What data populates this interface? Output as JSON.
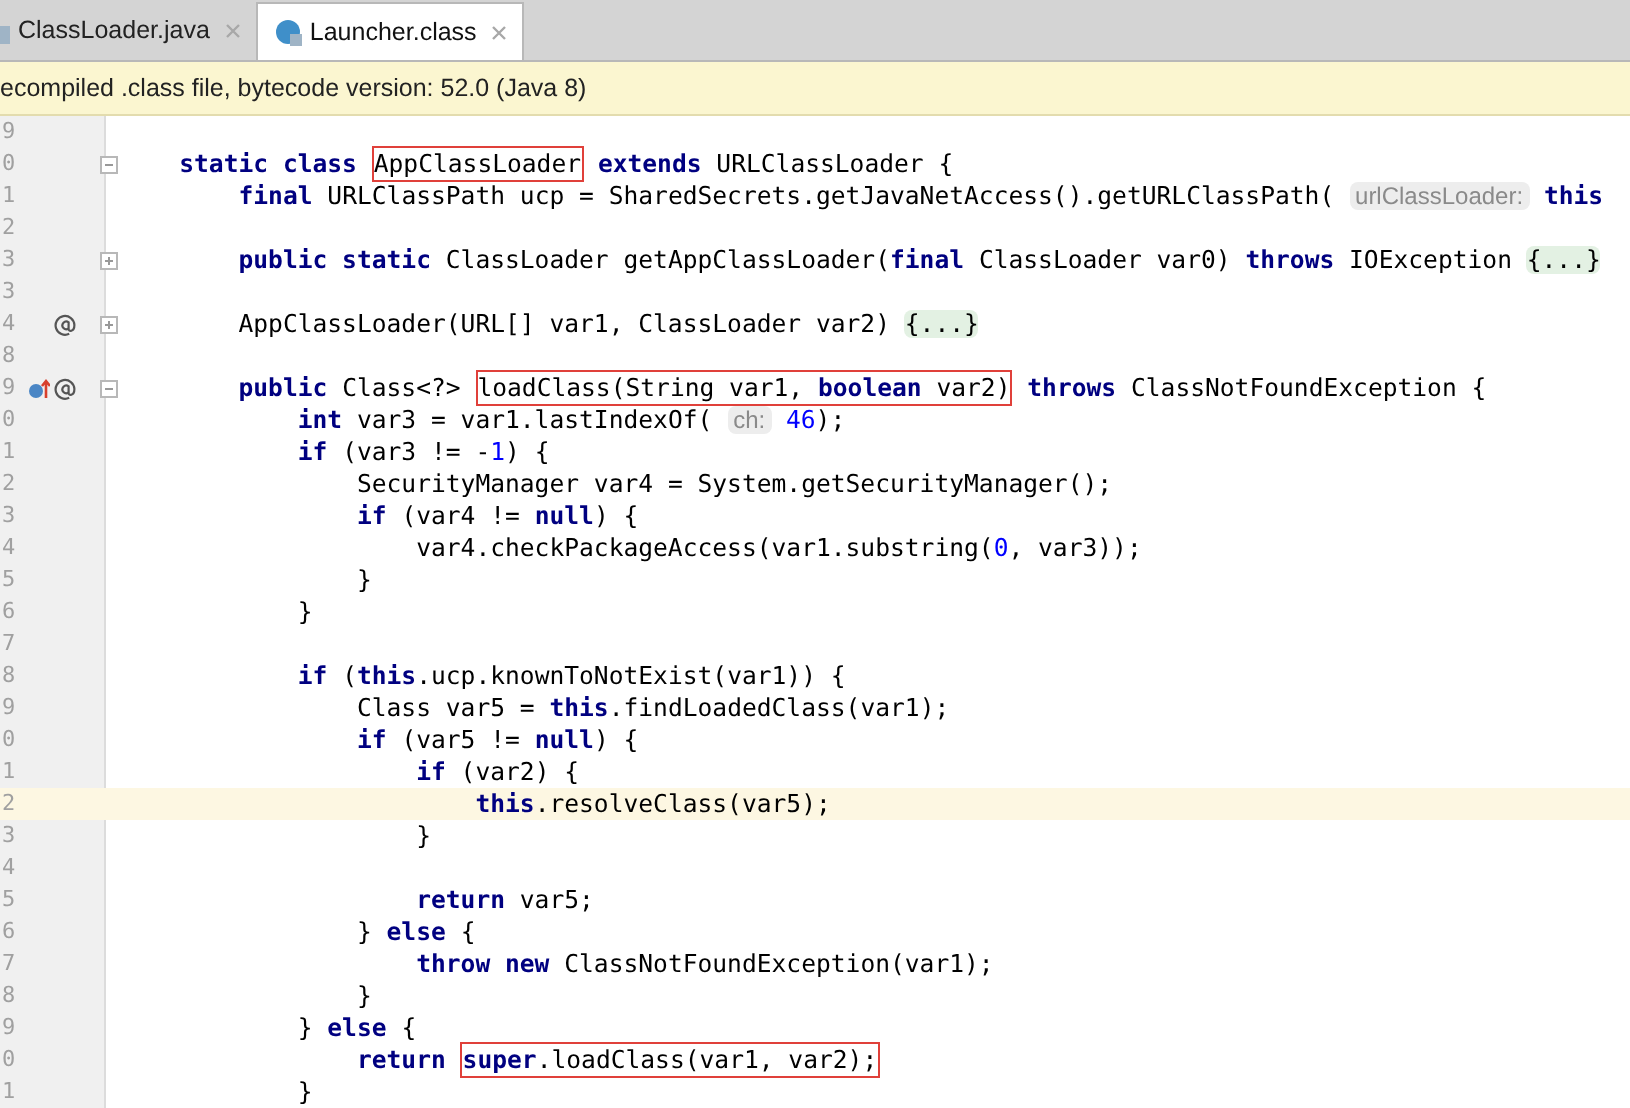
{
  "tabs": [
    {
      "label": "ClassLoader.java",
      "selected": false
    },
    {
      "label": "Launcher.class",
      "selected": true
    }
  ],
  "banner": "ecompiled .class file, bytecode version: 52.0 (Java 8)",
  "lines": [
    {
      "number": "9",
      "highlighted": false
    },
    {
      "number": "0",
      "highlighted": false,
      "expanded": true,
      "code": [
        {
          "kind": "kw",
          "text": "    static class "
        },
        {
          "kind": "box",
          "parts": [
            {
              "kind": "text",
              "text": "AppClassLoader"
            }
          ]
        },
        {
          "kind": "kw",
          "text": " extends "
        },
        {
          "kind": "text",
          "text": "URLClassLoader {"
        }
      ]
    },
    {
      "number": "1",
      "highlighted": false,
      "code": [
        {
          "kind": "kw",
          "text": "        final "
        },
        {
          "kind": "text",
          "text": "URLClassPath ucp = SharedSecrets.getJavaNetAccess().getURLClassPath( "
        },
        {
          "kind": "hint",
          "text": "urlClassLoader:"
        },
        {
          "kind": "kw",
          "text": " this"
        }
      ]
    },
    {
      "number": "2",
      "highlighted": false
    },
    {
      "number": "3",
      "highlighted": false,
      "expanded": false,
      "code": [
        {
          "kind": "kw",
          "text": "        public static "
        },
        {
          "kind": "text",
          "text": "ClassLoader getAppClassLoader("
        },
        {
          "kind": "kw",
          "text": "final "
        },
        {
          "kind": "text",
          "text": "ClassLoader var0) "
        },
        {
          "kind": "kw",
          "text": "throws "
        },
        {
          "kind": "text",
          "text": "IOException "
        },
        {
          "kind": "fold",
          "text": "{...}"
        }
      ]
    },
    {
      "number": "3",
      "highlighted": false
    },
    {
      "number": "4",
      "highlighted": false,
      "expanded": false,
      "annotation_marker": true,
      "code": [
        {
          "kind": "text",
          "text": "        AppClassLoader(URL[] var1, ClassLoader var2) "
        },
        {
          "kind": "fold",
          "text": "{...}"
        }
      ]
    },
    {
      "number": "8",
      "highlighted": false
    },
    {
      "number": "9",
      "highlighted": false,
      "expanded": true,
      "override_marker": true,
      "annotation_marker": true,
      "code": [
        {
          "kind": "kw",
          "text": "        public "
        },
        {
          "kind": "text",
          "text": "Class<?> "
        },
        {
          "kind": "box",
          "parts": [
            {
              "kind": "text",
              "text": "loadClass(String var1, "
            },
            {
              "kind": "kw",
              "text": "boolean "
            },
            {
              "kind": "text",
              "text": "var2)"
            }
          ]
        },
        {
          "kind": "kw",
          "text": " throws "
        },
        {
          "kind": "text",
          "text": "ClassNotFoundException {"
        }
      ]
    },
    {
      "number": "0",
      "highlighted": false,
      "code": [
        {
          "kind": "kw",
          "text": "            int "
        },
        {
          "kind": "text",
          "text": "var3 = var1.lastIndexOf( "
        },
        {
          "kind": "hint",
          "text": "ch:"
        },
        {
          "kind": "num",
          "text": " 46"
        },
        {
          "kind": "text",
          "text": ");"
        }
      ]
    },
    {
      "number": "1",
      "highlighted": false,
      "code": [
        {
          "kind": "kw",
          "text": "            if "
        },
        {
          "kind": "text",
          "text": "(var3 != -"
        },
        {
          "kind": "num",
          "text": "1"
        },
        {
          "kind": "text",
          "text": ") {"
        }
      ]
    },
    {
      "number": "2",
      "highlighted": false,
      "code": [
        {
          "kind": "text",
          "text": "                SecurityManager var4 = System.getSecurityManager();"
        }
      ]
    },
    {
      "number": "3",
      "highlighted": false,
      "code": [
        {
          "kind": "kw",
          "text": "                if "
        },
        {
          "kind": "text",
          "text": "(var4 != "
        },
        {
          "kind": "kw",
          "text": "null"
        },
        {
          "kind": "text",
          "text": ") {"
        }
      ]
    },
    {
      "number": "4",
      "highlighted": false,
      "code": [
        {
          "kind": "text",
          "text": "                    var4.checkPackageAccess(var1.substring("
        },
        {
          "kind": "num",
          "text": "0"
        },
        {
          "kind": "text",
          "text": ", var3));"
        }
      ]
    },
    {
      "number": "5",
      "highlighted": false,
      "code": [
        {
          "kind": "text",
          "text": "                }"
        }
      ]
    },
    {
      "number": "6",
      "highlighted": false,
      "code": [
        {
          "kind": "text",
          "text": "            }"
        }
      ]
    },
    {
      "number": "7",
      "highlighted": false
    },
    {
      "number": "8",
      "highlighted": false,
      "code": [
        {
          "kind": "kw",
          "text": "            if "
        },
        {
          "kind": "text",
          "text": "("
        },
        {
          "kind": "kw",
          "text": "this"
        },
        {
          "kind": "text",
          "text": ".ucp.knownToNotExist(var1)) {"
        }
      ]
    },
    {
      "number": "9",
      "highlighted": false,
      "code": [
        {
          "kind": "text",
          "text": "                Class var5 = "
        },
        {
          "kind": "kw",
          "text": "this"
        },
        {
          "kind": "text",
          "text": ".findLoadedClass(var1);"
        }
      ]
    },
    {
      "number": "0",
      "highlighted": false,
      "code": [
        {
          "kind": "kw",
          "text": "                if "
        },
        {
          "kind": "text",
          "text": "(var5 != "
        },
        {
          "kind": "kw",
          "text": "null"
        },
        {
          "kind": "text",
          "text": ") {"
        }
      ]
    },
    {
      "number": "1",
      "highlighted": false,
      "code": [
        {
          "kind": "kw",
          "text": "                    if "
        },
        {
          "kind": "text",
          "text": "(var2) {"
        }
      ]
    },
    {
      "number": "2",
      "highlighted": true,
      "code": [
        {
          "kind": "kw",
          "text": "                        this"
        },
        {
          "kind": "text",
          "text": ".resolveClass(var5);"
        }
      ]
    },
    {
      "number": "3",
      "highlighted": false,
      "code": [
        {
          "kind": "text",
          "text": "                    }"
        }
      ]
    },
    {
      "number": "4",
      "highlighted": false
    },
    {
      "number": "5",
      "highlighted": false,
      "code": [
        {
          "kind": "kw",
          "text": "                    return "
        },
        {
          "kind": "text",
          "text": "var5;"
        }
      ]
    },
    {
      "number": "6",
      "highlighted": false,
      "code": [
        {
          "kind": "text",
          "text": "                } "
        },
        {
          "kind": "kw",
          "text": "else "
        },
        {
          "kind": "text",
          "text": "{"
        }
      ]
    },
    {
      "number": "7",
      "highlighted": false,
      "code": [
        {
          "kind": "kw",
          "text": "                    throw new "
        },
        {
          "kind": "text",
          "text": "ClassNotFoundException(var1);"
        }
      ]
    },
    {
      "number": "8",
      "highlighted": false,
      "code": [
        {
          "kind": "text",
          "text": "                }"
        }
      ]
    },
    {
      "number": "9",
      "highlighted": false,
      "code": [
        {
          "kind": "text",
          "text": "            } "
        },
        {
          "kind": "kw",
          "text": "else "
        },
        {
          "kind": "text",
          "text": "{"
        }
      ]
    },
    {
      "number": "0",
      "highlighted": false,
      "code": [
        {
          "kind": "kw",
          "text": "                return "
        },
        {
          "kind": "box",
          "parts": [
            {
              "kind": "kw",
              "text": "super"
            },
            {
              "kind": "text",
              "text": ".loadClass(var1, var2);"
            }
          ]
        }
      ]
    },
    {
      "number": "1",
      "highlighted": false,
      "code": [
        {
          "kind": "text",
          "text": "            }"
        }
      ]
    }
  ]
}
